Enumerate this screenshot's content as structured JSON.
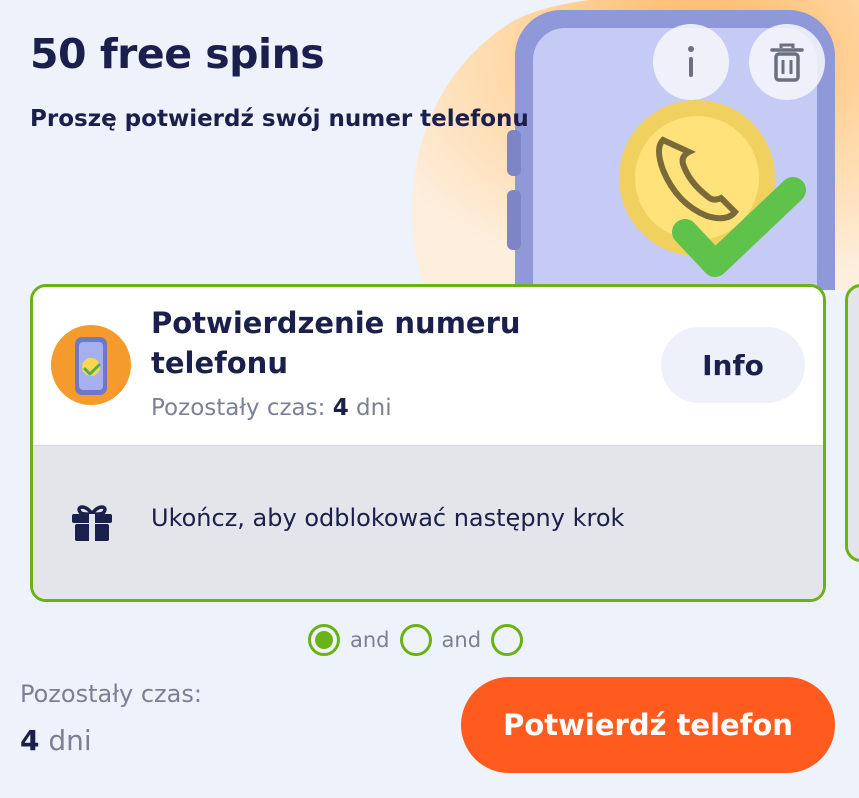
{
  "header": {
    "title": "50 free spins",
    "subtitle": "Proszę potwierdź swój numer telefonu",
    "info_button_icon": "info-icon",
    "delete_button_icon": "trash-icon"
  },
  "task_card": {
    "title": "Potwierdzenie numeru telefonu",
    "time_label": "Pozostały czas:",
    "time_value": "4",
    "time_unit": "dni",
    "info_button": "Info",
    "reward_icon": "gift-icon",
    "reward_text": "Ukończ, aby odblokować następny krok"
  },
  "steps": {
    "separator": "and",
    "items": [
      {
        "completed": true
      },
      {
        "completed": false
      },
      {
        "completed": false
      }
    ]
  },
  "footer": {
    "time_label": "Pozostały czas:",
    "time_value": "4",
    "time_unit": "dni",
    "cta_label": "Potwierdź telefon"
  },
  "colors": {
    "accent_green": "#6ab216",
    "cta_orange": "#ff5b1f",
    "text_navy": "#1a1f4b",
    "background": "#eef2fb"
  }
}
